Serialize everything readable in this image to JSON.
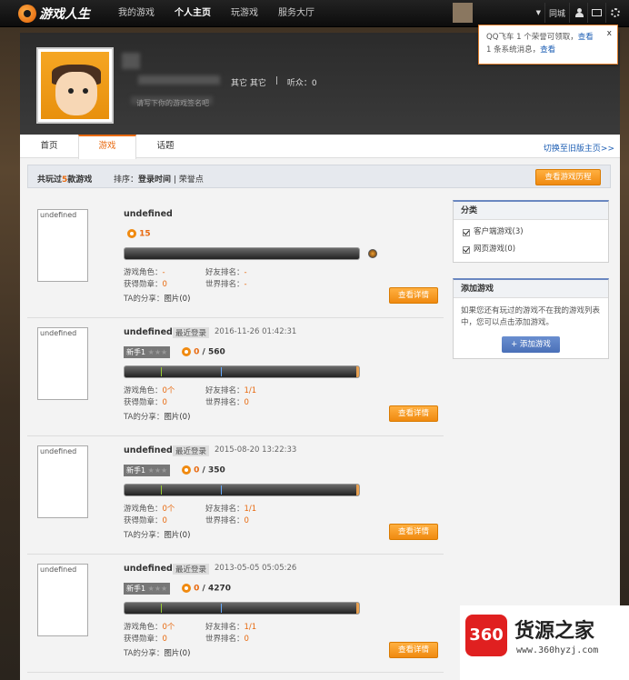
{
  "app": {
    "logo_text": "游戏人生"
  },
  "nav": [
    {
      "label": "我的游戏"
    },
    {
      "label": "个人主页"
    },
    {
      "label": "玩游戏"
    },
    {
      "label": "服务大厅"
    }
  ],
  "topbar": {
    "city_label": "同城"
  },
  "profile": {
    "meta1": "其它 其它",
    "sep": "|",
    "listeners": "听众：0",
    "signature": "请写下你的游戏签名吧"
  },
  "notify": {
    "line1_text": "QQ飞车 1 个荣誉可领取，",
    "line1_link": "查看",
    "line2_text": "1 条系统消息，",
    "line2_link": "查看",
    "close": "x"
  },
  "tabs": [
    {
      "label": "首页"
    },
    {
      "label": "游戏"
    },
    {
      "label": "话题"
    }
  ],
  "tab_link": "切换至旧版主页>>",
  "sortbar": {
    "prefix": "共玩过",
    "count": "5",
    "suffix": "款游戏",
    "sort_label": "排序：",
    "sort_time": "登录时间",
    "sort_sep": "|",
    "sort_honor": "荣誉点",
    "history_button": "查看游戏历程"
  },
  "games": [
    {
      "thumb": "undefined",
      "name": "undefined",
      "last_login_tag": "",
      "last_login": "",
      "level": "",
      "honor": "15",
      "honor_total": "",
      "role_label": "游戏角色：",
      "role_value": "-",
      "medal_label": "获得勋章：",
      "medal_value": "0",
      "friend_label": "好友排名：",
      "friend_value": "-",
      "world_label": "世界排名：",
      "world_value": "-",
      "share_label": "TA的分享：",
      "share_value": "图片(0)",
      "detail_button": "查看详情"
    },
    {
      "thumb": "undefined",
      "name": "undefined",
      "last_login_tag": "最近登录",
      "last_login": "2016-11-26 01:42:31",
      "level": "新手1",
      "honor": "0",
      "honor_total": "560",
      "role_label": "游戏角色：",
      "role_value": "0个",
      "medal_label": "获得勋章：",
      "medal_value": "0",
      "friend_label": "好友排名：",
      "friend_value": "1/1",
      "world_label": "世界排名：",
      "world_value": "0",
      "share_label": "TA的分享：",
      "share_value": "图片(0)",
      "detail_button": "查看详情"
    },
    {
      "thumb": "undefined",
      "name": "undefined",
      "last_login_tag": "最近登录",
      "last_login": "2015-08-20 13:22:33",
      "level": "新手1",
      "honor": "0",
      "honor_total": "350",
      "role_label": "游戏角色：",
      "role_value": "0个",
      "medal_label": "获得勋章：",
      "medal_value": "0",
      "friend_label": "好友排名：",
      "friend_value": "1/1",
      "world_label": "世界排名：",
      "world_value": "0",
      "share_label": "TA的分享：",
      "share_value": "图片(0)",
      "detail_button": "查看详情"
    },
    {
      "thumb": "undefined",
      "name": "undefined",
      "last_login_tag": "最近登录",
      "last_login": "2013-05-05 05:05:26",
      "level": "新手1",
      "honor": "0",
      "honor_total": "4270",
      "role_label": "游戏角色：",
      "role_value": "0个",
      "medal_label": "获得勋章：",
      "medal_value": "0",
      "friend_label": "好友排名：",
      "friend_value": "1/1",
      "world_label": "世界排名：",
      "world_value": "0",
      "share_label": "TA的分享：",
      "share_value": "图片(0)",
      "detail_button": "查看详情"
    }
  ],
  "honor_sep": "/",
  "stars": "★★★",
  "sidebar": {
    "category_title": "分类",
    "cat_client": "客户端游戏(3)",
    "cat_web": "网页游戏(0)",
    "add_title": "添加游戏",
    "add_text": "如果您还有玩过的游戏不在我的游戏列表中，您可以点击添加游戏。",
    "add_button": "+ 添加游戏"
  },
  "watermark": {
    "badge": "360",
    "title": "货源之家",
    "url": "www.360hyzj.com"
  }
}
